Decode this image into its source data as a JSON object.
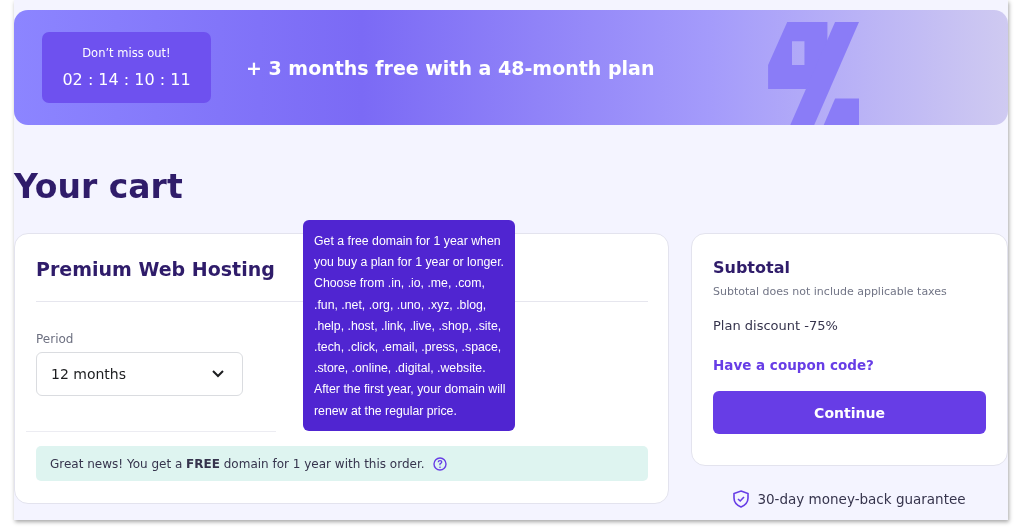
{
  "banner": {
    "timer_label": "Don’t miss out!",
    "countdown": "02 : 14 : 10 : 11",
    "offer": "+ 3 months free with a 48-month plan"
  },
  "page_title": "Your cart",
  "product": {
    "name": "Premium Web Hosting",
    "period_label": "Period",
    "period_value": "12 months",
    "notice": "Great news! You get a **FREE** domain for 1 year with this order."
  },
  "tooltip": "Get a free domain for 1 year when you buy a plan for 1 year or longer. Choose from .in, .io, .me, .com, .fun, .net, .org, .uno, .xyz, .blog, .help, .host, .link, .live, .shop, .site, .tech, .click, .email, .press, .space, .store, .online, .digital, .website. After the first year, your domain will renew at the regular price.",
  "summary": {
    "title": "Subtotal",
    "note": "Subtotal does not include applicable taxes",
    "discount": "Plan discount -75%",
    "coupon_link": "Have a coupon code?",
    "button": "Continue"
  },
  "guarantee": "30-day money-back guarantee"
}
